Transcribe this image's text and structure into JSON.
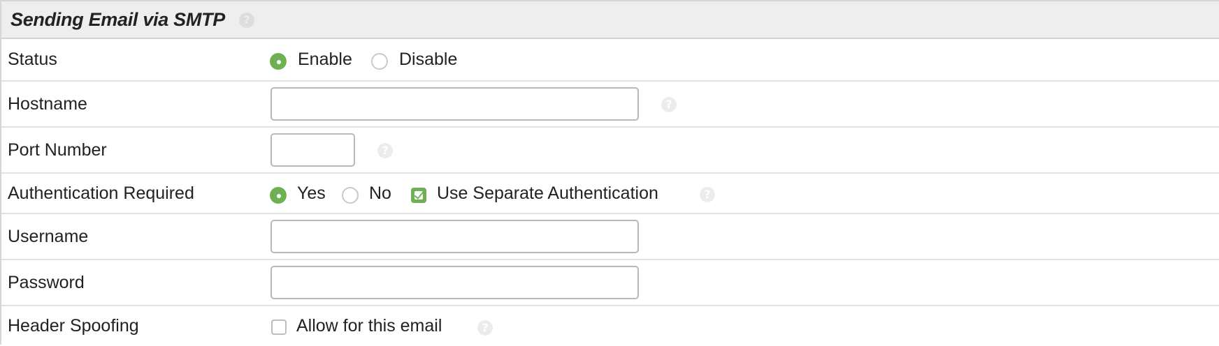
{
  "section": {
    "title": "Sending Email via SMTP",
    "help_icon": "question-circle-icon"
  },
  "rows": {
    "status": {
      "label": "Status",
      "options": [
        "Enable",
        "Disable"
      ],
      "selected": "Enable"
    },
    "hostname": {
      "label": "Hostname",
      "value": ""
    },
    "port": {
      "label": "Port Number",
      "value": ""
    },
    "auth": {
      "label": "Authentication Required",
      "options": [
        "Yes",
        "No"
      ],
      "selected": "Yes",
      "separate_label": "Use Separate Authentication",
      "separate_checked": true
    },
    "username": {
      "label": "Username",
      "value": ""
    },
    "password": {
      "label": "Password",
      "value": ""
    },
    "spoofing": {
      "label": "Header Spoofing",
      "checkbox_label": "Allow for this email",
      "checked": false
    }
  },
  "colors": {
    "accent": "#6fb052",
    "header_bg": "#eeeeee",
    "border": "#e2e2e2"
  }
}
